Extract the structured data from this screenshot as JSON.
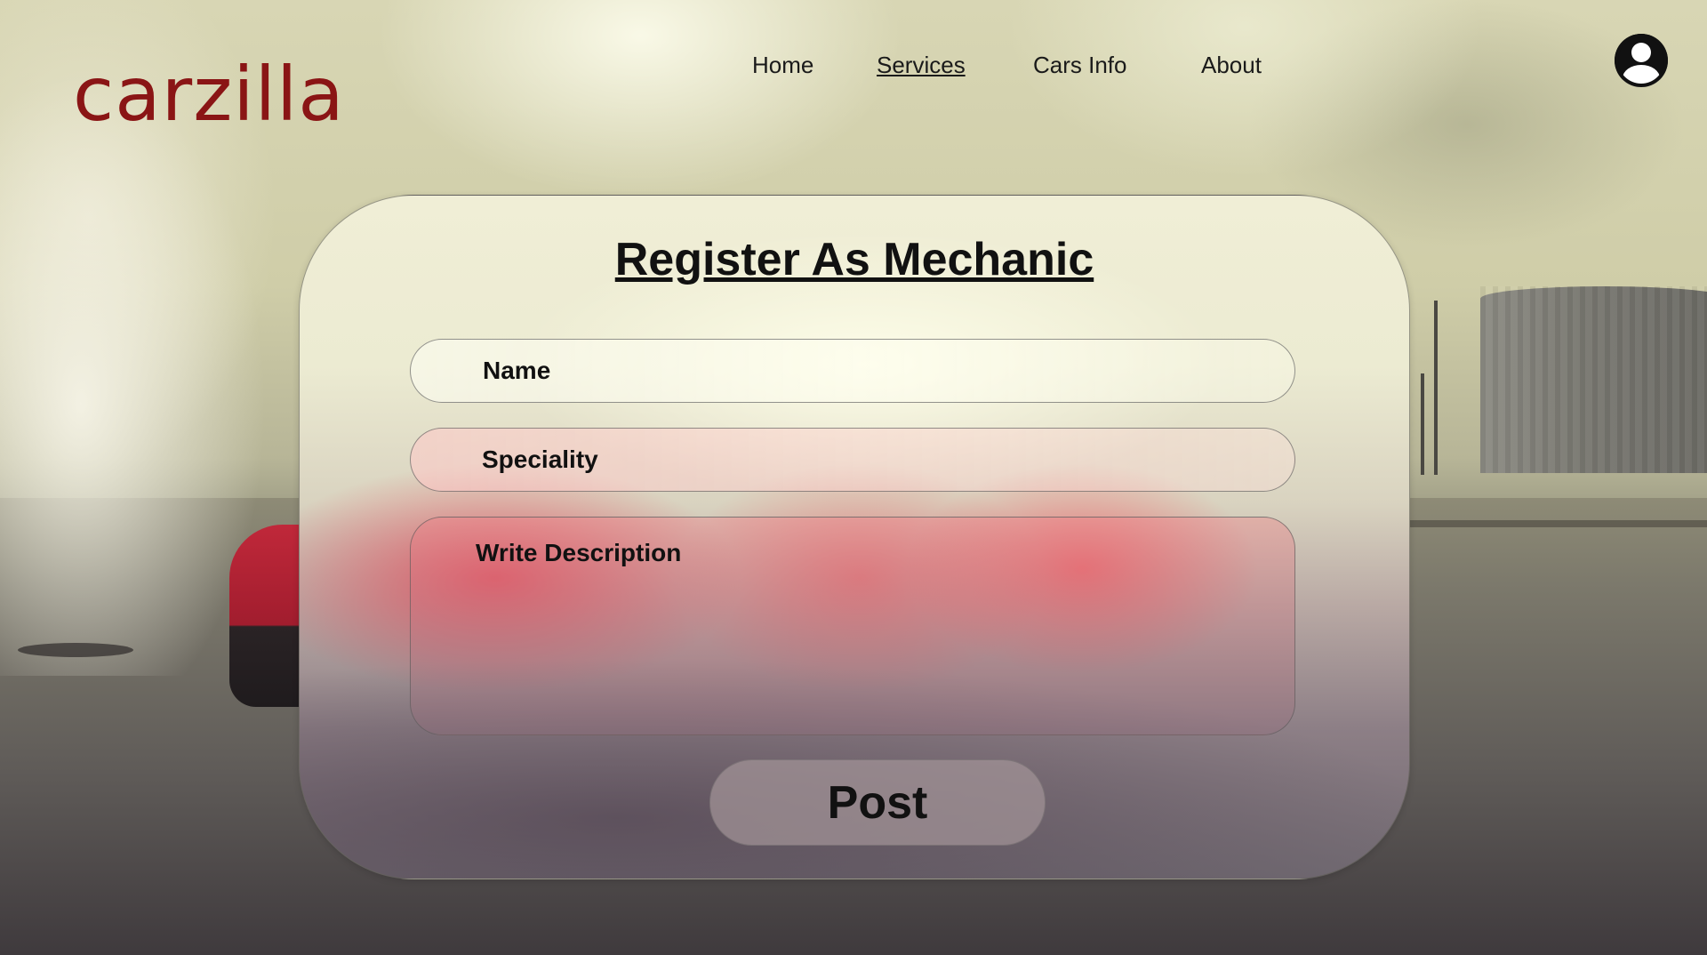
{
  "brand": {
    "logo": "carzilla",
    "logo_color": "#8a1515"
  },
  "nav": {
    "items": [
      {
        "label": "Home",
        "active": false
      },
      {
        "label": "Services",
        "active": true
      },
      {
        "label": "Cars Info",
        "active": false
      },
      {
        "label": "About",
        "active": false
      }
    ]
  },
  "header": {
    "profile_icon": "user-circle-icon"
  },
  "form": {
    "title": "Register As Mechanic",
    "name_placeholder": "Name",
    "speciality_placeholder": "Speciality",
    "description_placeholder": "Write Description",
    "submit_label": "Post"
  }
}
